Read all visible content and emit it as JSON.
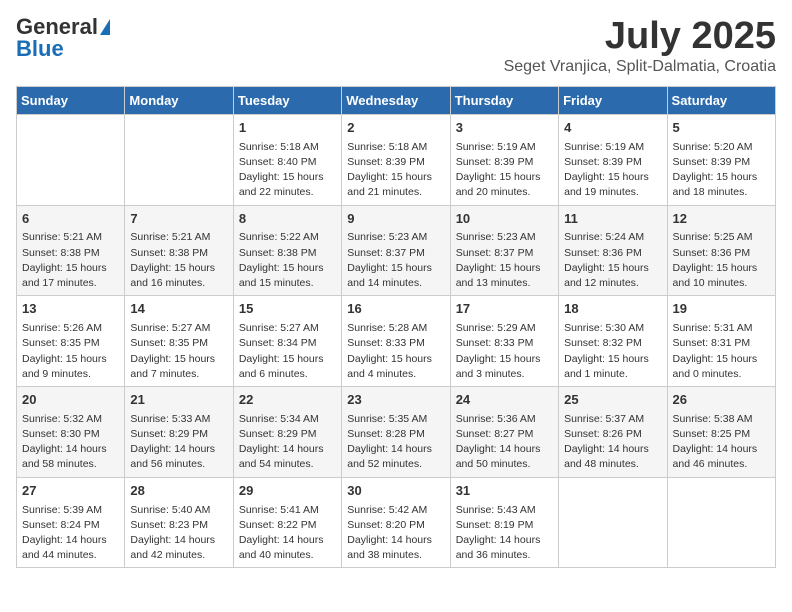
{
  "logo": {
    "general": "General",
    "blue": "Blue"
  },
  "title": {
    "month": "July 2025",
    "location": "Seget Vranjica, Split-Dalmatia, Croatia"
  },
  "headers": [
    "Sunday",
    "Monday",
    "Tuesday",
    "Wednesday",
    "Thursday",
    "Friday",
    "Saturday"
  ],
  "weeks": [
    [
      {
        "day": "",
        "info": ""
      },
      {
        "day": "",
        "info": ""
      },
      {
        "day": "1",
        "info": "Sunrise: 5:18 AM\nSunset: 8:40 PM\nDaylight: 15 hours\nand 22 minutes."
      },
      {
        "day": "2",
        "info": "Sunrise: 5:18 AM\nSunset: 8:39 PM\nDaylight: 15 hours\nand 21 minutes."
      },
      {
        "day": "3",
        "info": "Sunrise: 5:19 AM\nSunset: 8:39 PM\nDaylight: 15 hours\nand 20 minutes."
      },
      {
        "day": "4",
        "info": "Sunrise: 5:19 AM\nSunset: 8:39 PM\nDaylight: 15 hours\nand 19 minutes."
      },
      {
        "day": "5",
        "info": "Sunrise: 5:20 AM\nSunset: 8:39 PM\nDaylight: 15 hours\nand 18 minutes."
      }
    ],
    [
      {
        "day": "6",
        "info": "Sunrise: 5:21 AM\nSunset: 8:38 PM\nDaylight: 15 hours\nand 17 minutes."
      },
      {
        "day": "7",
        "info": "Sunrise: 5:21 AM\nSunset: 8:38 PM\nDaylight: 15 hours\nand 16 minutes."
      },
      {
        "day": "8",
        "info": "Sunrise: 5:22 AM\nSunset: 8:38 PM\nDaylight: 15 hours\nand 15 minutes."
      },
      {
        "day": "9",
        "info": "Sunrise: 5:23 AM\nSunset: 8:37 PM\nDaylight: 15 hours\nand 14 minutes."
      },
      {
        "day": "10",
        "info": "Sunrise: 5:23 AM\nSunset: 8:37 PM\nDaylight: 15 hours\nand 13 minutes."
      },
      {
        "day": "11",
        "info": "Sunrise: 5:24 AM\nSunset: 8:36 PM\nDaylight: 15 hours\nand 12 minutes."
      },
      {
        "day": "12",
        "info": "Sunrise: 5:25 AM\nSunset: 8:36 PM\nDaylight: 15 hours\nand 10 minutes."
      }
    ],
    [
      {
        "day": "13",
        "info": "Sunrise: 5:26 AM\nSunset: 8:35 PM\nDaylight: 15 hours\nand 9 minutes."
      },
      {
        "day": "14",
        "info": "Sunrise: 5:27 AM\nSunset: 8:35 PM\nDaylight: 15 hours\nand 7 minutes."
      },
      {
        "day": "15",
        "info": "Sunrise: 5:27 AM\nSunset: 8:34 PM\nDaylight: 15 hours\nand 6 minutes."
      },
      {
        "day": "16",
        "info": "Sunrise: 5:28 AM\nSunset: 8:33 PM\nDaylight: 15 hours\nand 4 minutes."
      },
      {
        "day": "17",
        "info": "Sunrise: 5:29 AM\nSunset: 8:33 PM\nDaylight: 15 hours\nand 3 minutes."
      },
      {
        "day": "18",
        "info": "Sunrise: 5:30 AM\nSunset: 8:32 PM\nDaylight: 15 hours\nand 1 minute."
      },
      {
        "day": "19",
        "info": "Sunrise: 5:31 AM\nSunset: 8:31 PM\nDaylight: 15 hours\nand 0 minutes."
      }
    ],
    [
      {
        "day": "20",
        "info": "Sunrise: 5:32 AM\nSunset: 8:30 PM\nDaylight: 14 hours\nand 58 minutes."
      },
      {
        "day": "21",
        "info": "Sunrise: 5:33 AM\nSunset: 8:29 PM\nDaylight: 14 hours\nand 56 minutes."
      },
      {
        "day": "22",
        "info": "Sunrise: 5:34 AM\nSunset: 8:29 PM\nDaylight: 14 hours\nand 54 minutes."
      },
      {
        "day": "23",
        "info": "Sunrise: 5:35 AM\nSunset: 8:28 PM\nDaylight: 14 hours\nand 52 minutes."
      },
      {
        "day": "24",
        "info": "Sunrise: 5:36 AM\nSunset: 8:27 PM\nDaylight: 14 hours\nand 50 minutes."
      },
      {
        "day": "25",
        "info": "Sunrise: 5:37 AM\nSunset: 8:26 PM\nDaylight: 14 hours\nand 48 minutes."
      },
      {
        "day": "26",
        "info": "Sunrise: 5:38 AM\nSunset: 8:25 PM\nDaylight: 14 hours\nand 46 minutes."
      }
    ],
    [
      {
        "day": "27",
        "info": "Sunrise: 5:39 AM\nSunset: 8:24 PM\nDaylight: 14 hours\nand 44 minutes."
      },
      {
        "day": "28",
        "info": "Sunrise: 5:40 AM\nSunset: 8:23 PM\nDaylight: 14 hours\nand 42 minutes."
      },
      {
        "day": "29",
        "info": "Sunrise: 5:41 AM\nSunset: 8:22 PM\nDaylight: 14 hours\nand 40 minutes."
      },
      {
        "day": "30",
        "info": "Sunrise: 5:42 AM\nSunset: 8:20 PM\nDaylight: 14 hours\nand 38 minutes."
      },
      {
        "day": "31",
        "info": "Sunrise: 5:43 AM\nSunset: 8:19 PM\nDaylight: 14 hours\nand 36 minutes."
      },
      {
        "day": "",
        "info": ""
      },
      {
        "day": "",
        "info": ""
      }
    ]
  ]
}
